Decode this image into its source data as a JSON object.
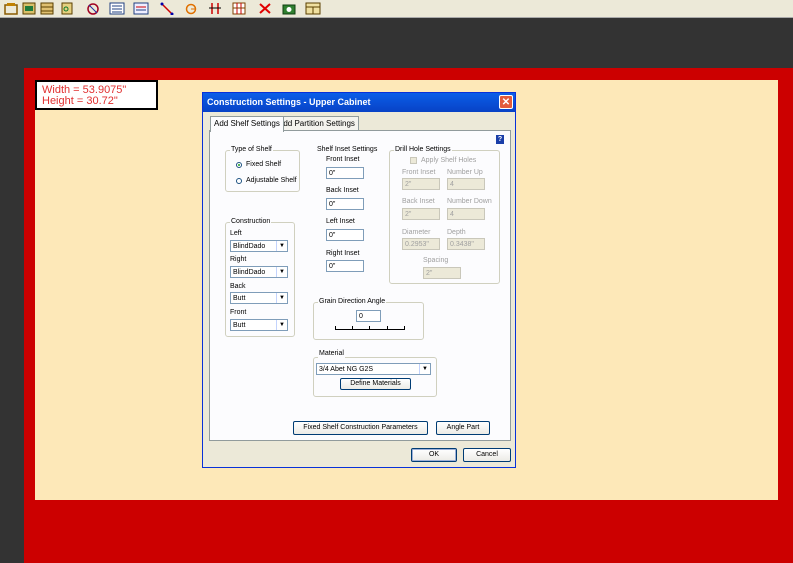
{
  "toolbar": {
    "icons": [
      "cabinet-icon",
      "drawer-icon",
      "stack-icon",
      "door-icon",
      "settings-icon",
      "list-icon",
      "part-list-icon",
      "measure-icon",
      "rotate-icon",
      "split-icon",
      "grid-icon",
      "delete-icon",
      "camera-icon",
      "layout-icon"
    ]
  },
  "dimensions": {
    "width": "Width = 53.9075\"",
    "height": "Height = 30.72\""
  },
  "dialog": {
    "title": "Construction Settings - Upper Cabinet",
    "close": "✕",
    "tabs": [
      "Add Shelf Settings",
      "Add Partition Settings"
    ],
    "help": "?",
    "type_of_shelf": {
      "label": "Type of Shelf",
      "options": [
        "Fixed Shelf",
        "Adjustable Shelf"
      ],
      "selected": "Fixed Shelf"
    },
    "construction": {
      "label": "Construction",
      "left_label": "Left",
      "left_value": "BlindDado",
      "right_label": "Right",
      "right_value": "BlindDado",
      "back_label": "Back",
      "back_value": "Butt",
      "front_label": "Front",
      "front_value": "Butt"
    },
    "inset": {
      "label": "Shelf Inset Settings",
      "front_label": "Front Inset",
      "front_value": "0\"",
      "back_label": "Back Inset",
      "back_value": "0\"",
      "left_label": "Left Inset",
      "left_value": "0\"",
      "right_label": "Right Inset",
      "right_value": "0\""
    },
    "drill": {
      "label": "Drill Hole Settings",
      "apply_label": "Apply Shelf Holes",
      "front_inset_label": "Front Inset",
      "front_inset_value": "2\"",
      "number_up_label": "Number Up",
      "number_up_value": "4",
      "back_inset_label": "Back Inset",
      "back_inset_value": "2\"",
      "number_down_label": "Number Down",
      "number_down_value": "4",
      "diameter_label": "Diameter",
      "diameter_value": "0.2953\"",
      "depth_label": "Depth",
      "depth_value": "0.3438\"",
      "spacing_label": "Spacing",
      "spacing_value": "2\""
    },
    "grain": {
      "label": "Grain Direction Angle",
      "value": "0"
    },
    "material": {
      "label": "Material",
      "value": "3/4 Abet NG G2S",
      "define_button": "Define Materials"
    },
    "fixed_params_button": "Fixed Shelf Construction Parameters",
    "angle_part_button": "Angle Part",
    "ok_button": "OK",
    "cancel_button": "Cancel"
  }
}
